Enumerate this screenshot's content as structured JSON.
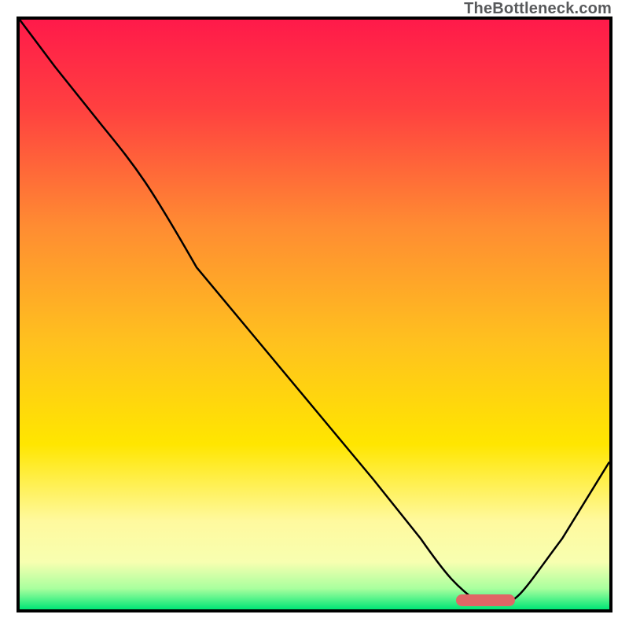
{
  "attribution": "TheBottleneck.com",
  "chart_data": {
    "type": "line",
    "title": "",
    "xlabel": "",
    "ylabel": "",
    "xlim": [
      0,
      100
    ],
    "ylim": [
      0,
      100
    ],
    "axes_visible": false,
    "legend": false,
    "background_gradient": [
      {
        "stop": 0.0,
        "color": "#ff1a4a"
      },
      {
        "stop": 0.15,
        "color": "#ff4040"
      },
      {
        "stop": 0.35,
        "color": "#ff8c32"
      },
      {
        "stop": 0.55,
        "color": "#ffc21e"
      },
      {
        "stop": 0.72,
        "color": "#ffe600"
      },
      {
        "stop": 0.85,
        "color": "#fff99e"
      },
      {
        "stop": 0.92,
        "color": "#f7ffb0"
      },
      {
        "stop": 0.965,
        "color": "#a8ff9e"
      },
      {
        "stop": 1.0,
        "color": "#00e676"
      }
    ],
    "series": [
      {
        "name": "bottleneck-curve",
        "stroke": "#000000",
        "stroke_width": 2.5,
        "x": [
          0,
          6,
          14,
          22,
          30,
          40,
          50,
          60,
          68,
          74,
          78,
          82,
          86,
          92,
          100
        ],
        "y": [
          100,
          92,
          82,
          72,
          58,
          46,
          34,
          22,
          12,
          4,
          1,
          1,
          4,
          12,
          25
        ]
      }
    ],
    "markers": [
      {
        "name": "optimal-range-bar",
        "shape": "rounded-rect",
        "fill": "#e06666",
        "x_start": 74,
        "x_end": 84,
        "y": 1.5,
        "height_pct": 2
      }
    ]
  }
}
